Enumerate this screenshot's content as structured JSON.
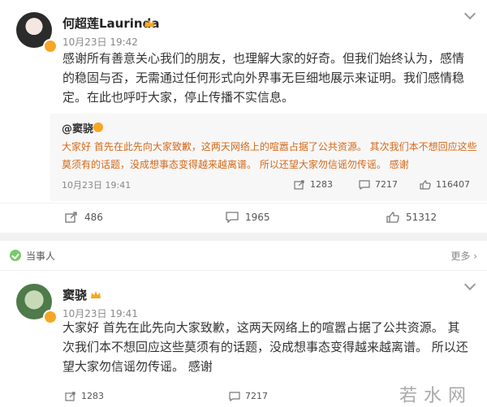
{
  "post1": {
    "username": "何超莲Laurinda",
    "time": "10月23日 19:42",
    "text": "感谢所有善意关心我们的朋友，也理解大家的好奇。但我们始终认为，感情的稳固与否，无需通过任何形式向外界事无巨细地展示来证明。我们感情稳定。在此也呼吁大家，停止传播不实信息。",
    "repost": {
      "username": "@窦骁",
      "text": "大家好 首先在此先向大家致歉，这两天网络上的喧嚣占据了公共资源。 其次我们本不想回应这些莫须有的话题，没成想事态变得越来越离谱。 所以还望大家勿信谣勿传谣。 感谢",
      "time": "10月23日 19:41",
      "reposts": "1283",
      "comments": "7217",
      "likes": "116407"
    },
    "actions": {
      "reposts": "486",
      "comments": "1965",
      "likes": "51312"
    }
  },
  "section": {
    "label": "当事人",
    "more": "更多"
  },
  "post2": {
    "username": "窦骁",
    "time": "10月23日 19:41",
    "text": "大家好 首先在此先向大家致歉，这两天网络上的喧嚣占据了公共资源。 其次我们本不想回应这些莫须有的话题，没成想事态变得越来越离谱。 所以还望大家勿信谣勿传谣。 感谢",
    "reposts": "1283",
    "comments": "7217"
  },
  "watermark": "若水网",
  "colors": {
    "accent_orange": "#f6a623",
    "repost_text": "#d4691a",
    "badge_green": "#7bc86b"
  }
}
